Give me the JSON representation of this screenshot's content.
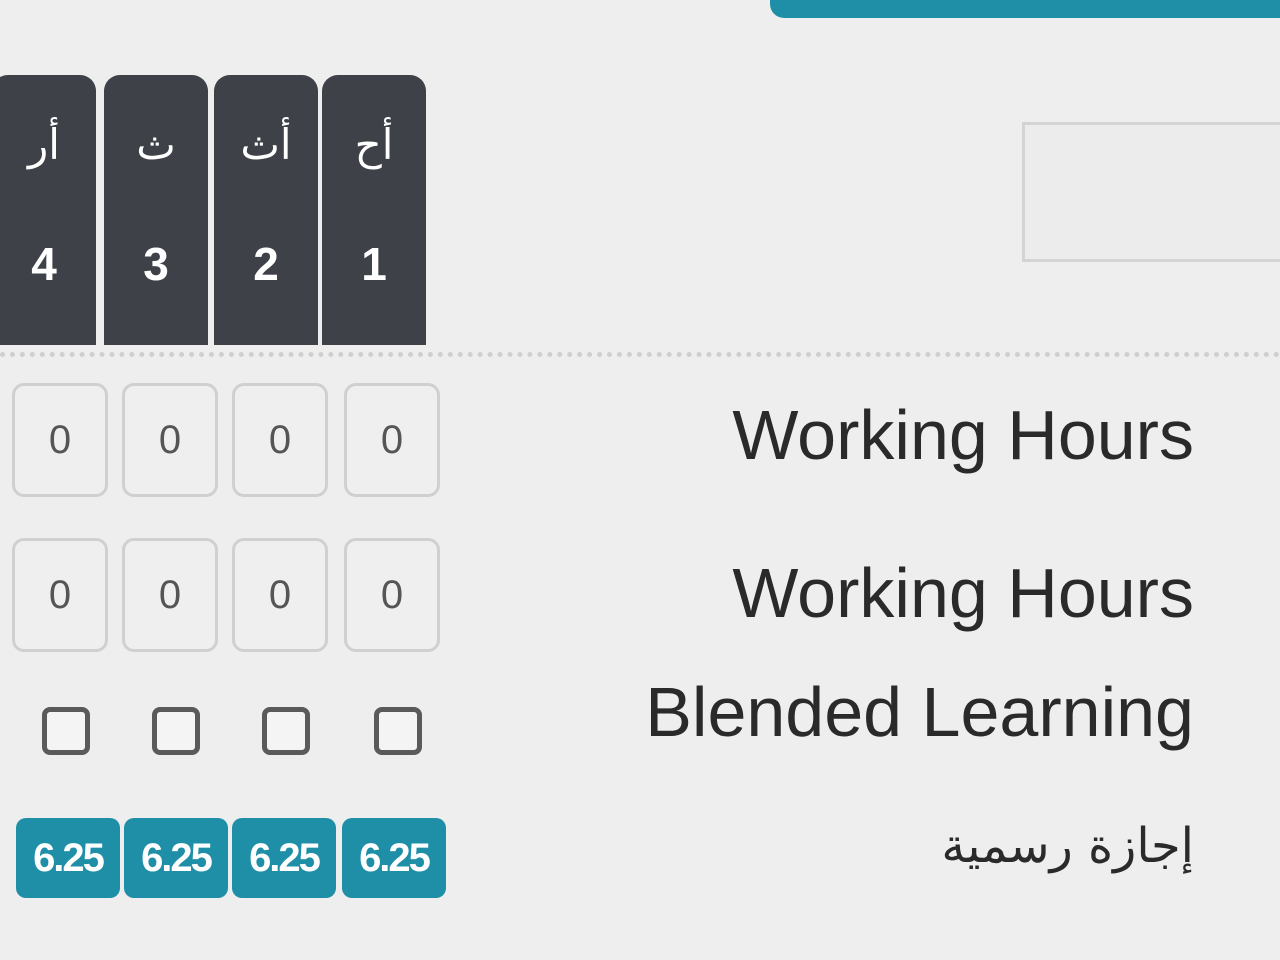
{
  "days": [
    {
      "abbr": "أر",
      "num": "4"
    },
    {
      "abbr": "ث",
      "num": "3"
    },
    {
      "abbr": "أث",
      "num": "2"
    },
    {
      "abbr": "أح",
      "num": "1"
    }
  ],
  "rows": {
    "working_hours_1": {
      "label": "Working Hours",
      "values": [
        "0",
        "0",
        "0",
        "0"
      ]
    },
    "working_hours_2": {
      "label": "Working Hours",
      "values": [
        "0",
        "0",
        "0",
        "0"
      ]
    },
    "blended_learning": {
      "label": "Blended Learning",
      "checked": [
        false,
        false,
        false,
        false
      ]
    },
    "official_holiday": {
      "label": "إجازة رسمية",
      "values": [
        "6.25",
        "6.25",
        "6.25",
        "6.25"
      ]
    }
  },
  "colors": {
    "accent": "#1f8fa8",
    "header_bg": "#3e4148"
  }
}
